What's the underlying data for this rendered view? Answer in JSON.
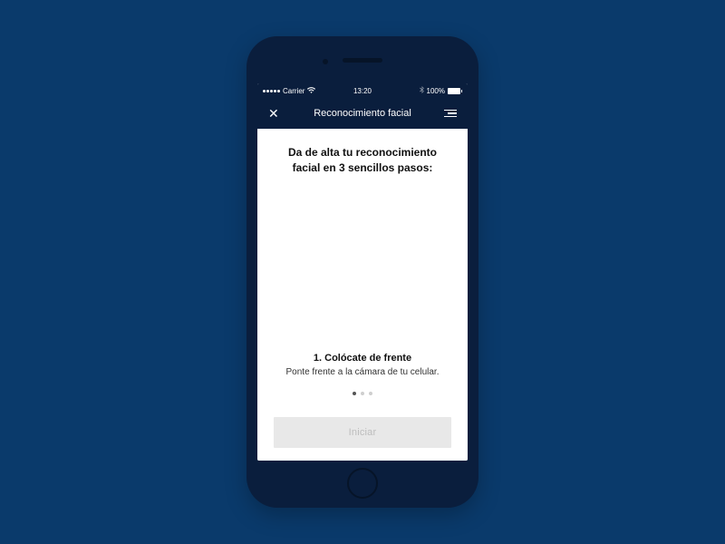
{
  "status_bar": {
    "carrier": "Carrier",
    "wifi_icon": "wifi",
    "time": "13:20",
    "bluetooth_icon": "bluetooth",
    "battery_pct": "100%"
  },
  "nav": {
    "close_icon": "✕",
    "title": "Reconocimiento facial",
    "menu_icon": "menu"
  },
  "content": {
    "heading": "Da de alta tu reconocimiento facial en 3 sencillos pasos:",
    "step_title": "1. Colócate de frente",
    "step_desc": "Ponte frente a la cámara de tu celular."
  },
  "pager": {
    "count": 3,
    "active_index": 0
  },
  "cta": {
    "label": "Iniciar"
  }
}
